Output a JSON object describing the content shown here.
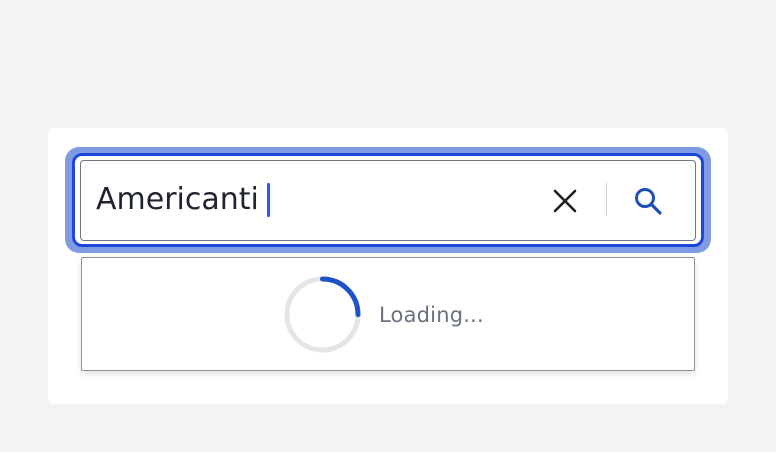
{
  "search": {
    "value": "Americanti",
    "clear_icon": "close-icon",
    "search_icon": "search-icon"
  },
  "dropdown": {
    "loading_text": "Loading...",
    "spinner_icon": "loading-spinner",
    "spinner_progress_fraction": 0.25
  },
  "colors": {
    "accent": "#1d47d6",
    "focus_ring": "#7f9be3",
    "caret": "#2f5ce8",
    "spinner_active": "#1c54c8",
    "spinner_track": "#e5e5e5"
  }
}
